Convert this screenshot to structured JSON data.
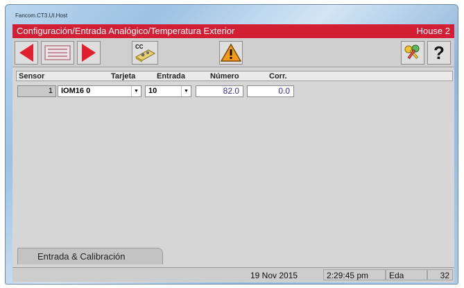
{
  "window": {
    "title": "Fancom.CT3.UI.Host"
  },
  "header": {
    "title": "Configuración/Entrada Analógico/Temperatura Exterior",
    "house": "House 2"
  },
  "toolbar": {
    "cc_label": "CC",
    "help_label": "?"
  },
  "columns": {
    "sensor": "Sensor",
    "tarjeta": "Tarjeta",
    "entrada": "Entrada",
    "numero": "Número",
    "corr": "Corr."
  },
  "row": {
    "sensor": "1",
    "tarjeta": "IOM16 0",
    "entrada": "10",
    "numero": "82.0",
    "corr": "0.0"
  },
  "tab": {
    "label": "Entrada & Calibración"
  },
  "status": {
    "date": "19 Nov 2015",
    "time": "2:29:45 pm",
    "user": "Eda",
    "number": "32"
  },
  "colors": {
    "header_red": "#d31f34",
    "arrow_red": "#e0202e",
    "warning_orange": "#f39a1a"
  }
}
